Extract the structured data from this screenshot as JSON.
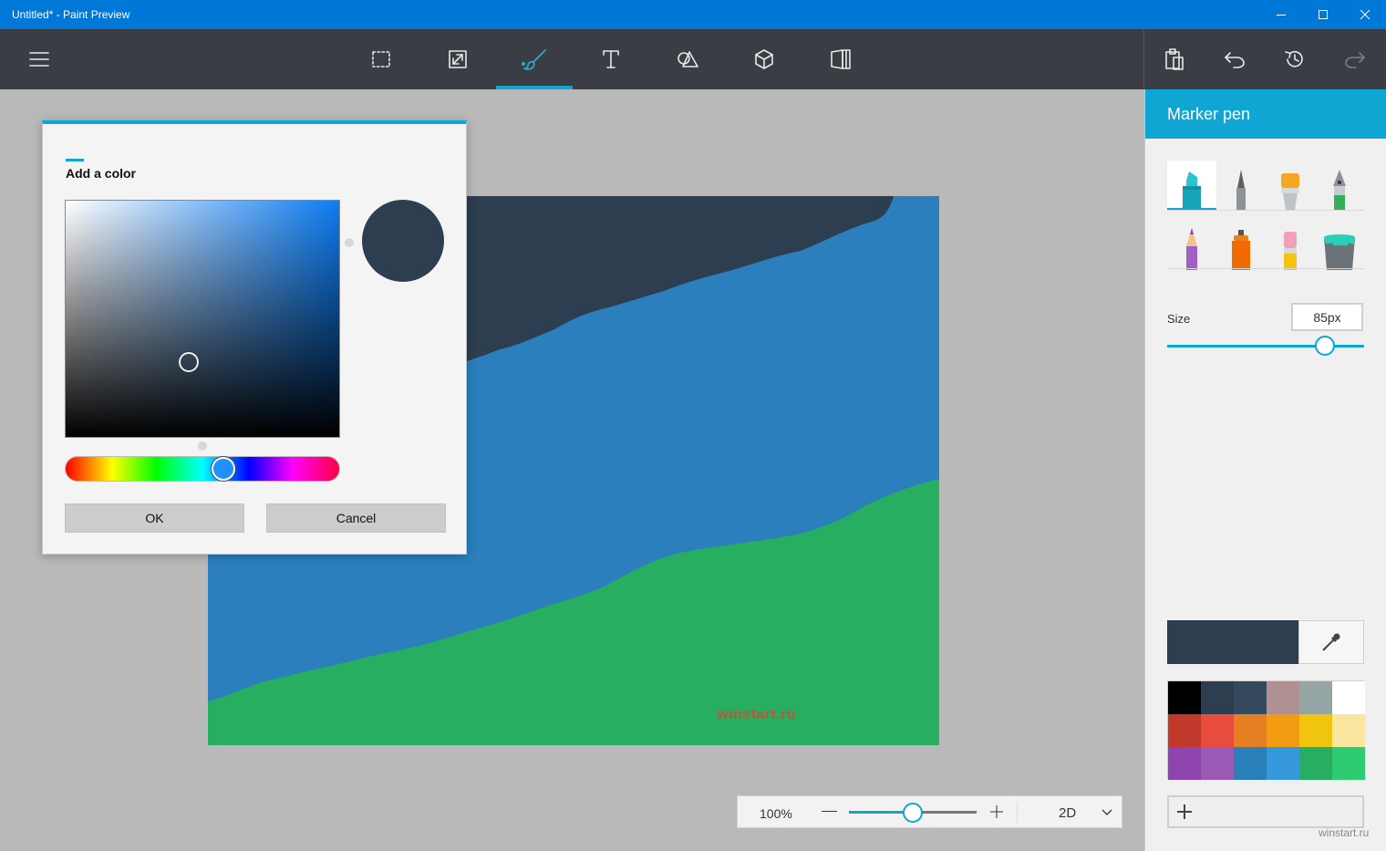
{
  "window": {
    "title": "Untitled* - Paint Preview"
  },
  "toolbar": {
    "menu_icon": "hamburger-icon",
    "tools": [
      {
        "name": "select",
        "icon": "select-dashed-rect-icon"
      },
      {
        "name": "resize",
        "icon": "resize-arrows-icon"
      },
      {
        "name": "brushes",
        "icon": "brush-icon",
        "active": true
      },
      {
        "name": "text",
        "icon": "text-T-icon"
      },
      {
        "name": "2d-shapes",
        "icon": "shapes-icon"
      },
      {
        "name": "3d-objects",
        "icon": "cube-icon"
      },
      {
        "name": "stickers",
        "icon": "book-icon"
      }
    ],
    "actions": [
      "paste-icon",
      "undo-icon",
      "history-icon",
      "redo-icon"
    ]
  },
  "color_dialog": {
    "title": "Add a color",
    "selected_color": "#2c3e50",
    "hue_color": "#0d7cf2",
    "ok_label": "OK",
    "cancel_label": "Cancel"
  },
  "canvas": {
    "band_colors": [
      "#2c3e50",
      "#2a7fbc",
      "#27ae60"
    ],
    "watermark": "winstart.ru"
  },
  "zoom": {
    "value": "100%",
    "level_fraction": 0.5,
    "mode": "2D"
  },
  "panel": {
    "title": "Marker pen",
    "brushes": [
      {
        "name": "marker",
        "icon": "marker-icon",
        "selected": true
      },
      {
        "name": "calligraphy-pen",
        "icon": "calligraphy-pen-icon"
      },
      {
        "name": "oil-brush",
        "icon": "oil-brush-icon"
      },
      {
        "name": "fountain-pen",
        "icon": "fountain-pen-icon"
      },
      {
        "name": "pencil",
        "icon": "pencil-icon"
      },
      {
        "name": "spray-can",
        "icon": "spray-can-icon"
      },
      {
        "name": "eraser",
        "icon": "eraser-icon"
      },
      {
        "name": "fill",
        "icon": "fill-bucket-icon"
      }
    ],
    "size_label": "Size",
    "size_value": "85px",
    "size_fraction": 0.8,
    "current_color": "#2c3e50",
    "palette": [
      "#000000",
      "#2c3e50",
      "#34495e",
      "#b09090",
      "#95a5a6",
      "#ffffff",
      "#c0392b",
      "#e74c3c",
      "#e67e22",
      "#f39c12",
      "#f1c40f",
      "#f9e79f",
      "#8e44ad",
      "#9b59b6",
      "#2980b9",
      "#3498db",
      "#27ae60",
      "#2ecc71"
    ],
    "watermark": "winstart.ru"
  }
}
